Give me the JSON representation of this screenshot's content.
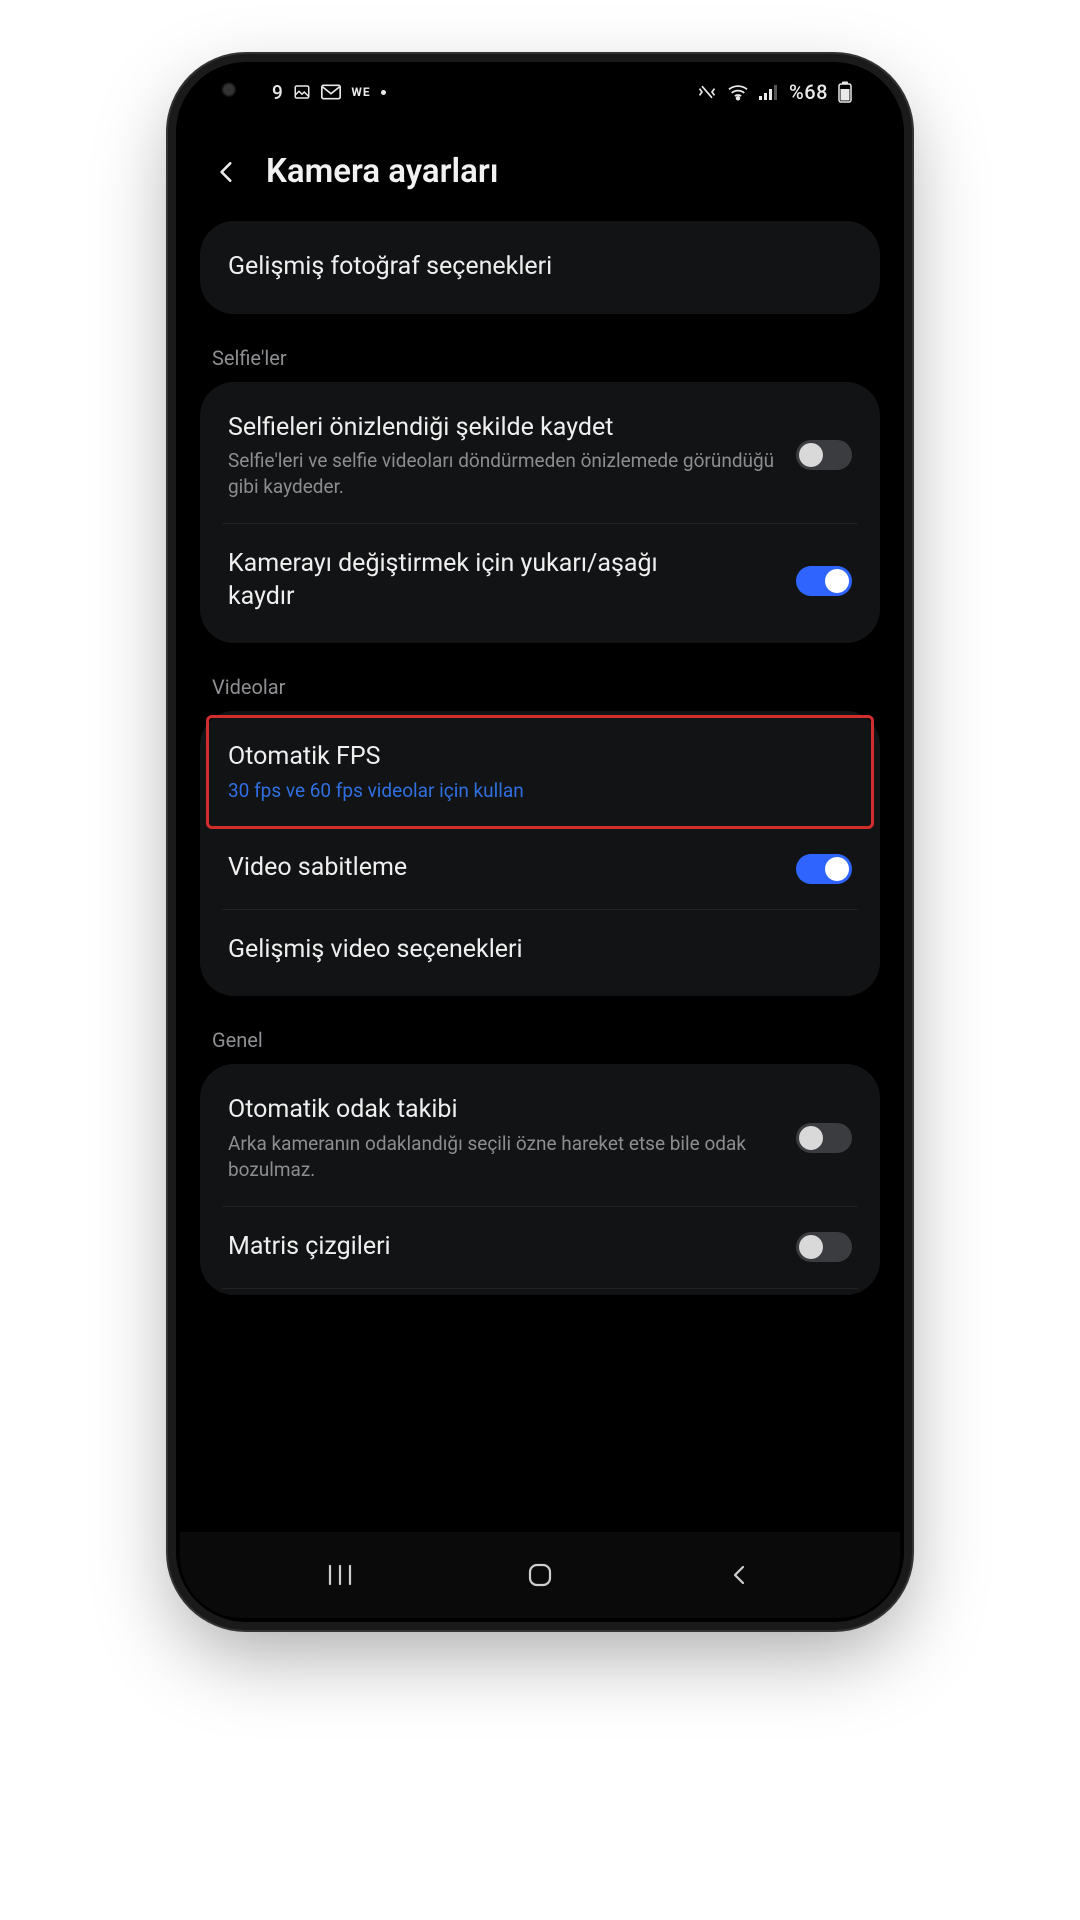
{
  "statusbar": {
    "time_fragment": "9",
    "we_label": "WE",
    "battery_text": "%68"
  },
  "header": {
    "title": "Kamera ayarları"
  },
  "card_top": {
    "row1": {
      "title": "Gelişmiş fotoğraf seçenekleri"
    }
  },
  "group_selfie": {
    "label": "Selfie'ler",
    "rows": [
      {
        "title": "Selfieleri önizlendiği şekilde kaydet",
        "sub": "Selfie'leri ve selfie videoları döndürmeden önizlemede göründüğü gibi kaydeder.",
        "on": false
      },
      {
        "title": "Kamerayı değiştirmek için yukarı/aşağı kaydır",
        "on": true
      }
    ]
  },
  "group_video": {
    "label": "Videolar",
    "rows": [
      {
        "title": "Otomatik FPS",
        "sub": "30 fps ve 60 fps videolar için kullan"
      },
      {
        "title": "Video sabitleme",
        "on": true
      },
      {
        "title": "Gelişmiş video seçenekleri"
      }
    ]
  },
  "group_general": {
    "label": "Genel",
    "rows": [
      {
        "title": "Otomatik odak takibi",
        "sub": "Arka kameranın odaklandığı seçili özne hareket etse bile odak bozulmaz.",
        "on": false
      },
      {
        "title": "Matris çizgileri",
        "on": false
      }
    ]
  }
}
